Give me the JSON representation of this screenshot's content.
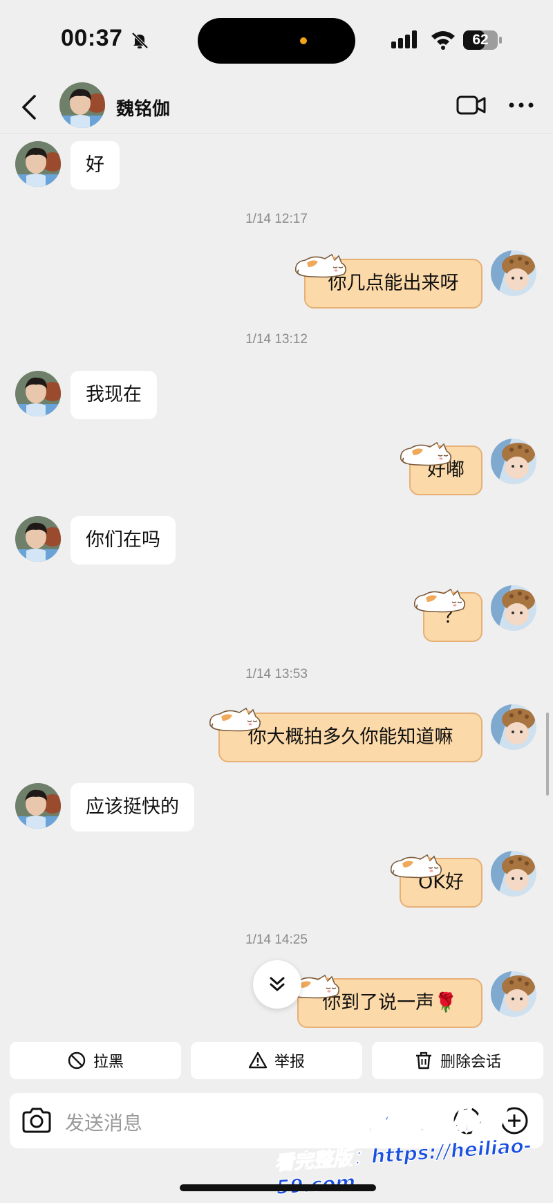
{
  "status_bar": {
    "time": "00:37",
    "battery": "62",
    "icons": [
      "bell-muted-icon",
      "signal-icon",
      "wifi-icon",
      "battery-icon"
    ]
  },
  "header": {
    "contact_name": "魏铭伽",
    "icons": [
      "back-icon",
      "video-call-icon",
      "more-icon"
    ]
  },
  "messages": [
    {
      "side": "in",
      "text": "好"
    },
    {
      "timestamp": "1/14 12:17"
    },
    {
      "side": "out",
      "text": "你几点能出来呀"
    },
    {
      "timestamp": "1/14 13:12"
    },
    {
      "side": "in",
      "text": "我现在"
    },
    {
      "side": "out",
      "text": "好嘟"
    },
    {
      "side": "in",
      "text": "你们在吗"
    },
    {
      "side": "out",
      "text": "？"
    },
    {
      "timestamp": "1/14 13:53"
    },
    {
      "side": "out",
      "text": "你大概拍多久你能知道嘛"
    },
    {
      "side": "in",
      "text": "应该挺快的"
    },
    {
      "side": "out",
      "text": "OK好"
    },
    {
      "timestamp": "1/14 14:25"
    },
    {
      "side": "out",
      "text": "你到了说一声🌹"
    }
  ],
  "actions": {
    "block": "拉黑",
    "report": "举报",
    "delete": "删除会话"
  },
  "input": {
    "placeholder": "发送消息"
  },
  "watermark": {
    "title": "黑料吃瓜网",
    "url": "看完整版：https://heiliao-59.com"
  },
  "colors": {
    "background": "#efefef",
    "outgoing_bubble": "#fcd9a8",
    "outgoing_border": "#e6b077",
    "incoming_bubble": "#ffffff",
    "watermark": "#1a4fe0"
  }
}
